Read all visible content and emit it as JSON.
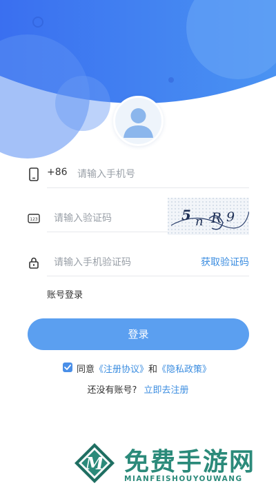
{
  "colors": {
    "header_blue": "#3d7af0",
    "accent_blue": "#3b8de0",
    "button_blue": "#5b9ff0",
    "watermark_green": "#2b8a7a"
  },
  "icons": {
    "phone": "phone-icon",
    "captcha": "captcha-123-icon",
    "lock": "lock-icon",
    "avatar": "user-avatar-icon",
    "checkbox": "check-icon"
  },
  "form": {
    "country_code": "+86",
    "phone_placeholder": "请输入手机号",
    "captcha_placeholder": "请输入验证码",
    "captcha_text": "5 n R 9",
    "sms_placeholder": "请输入手机验证码",
    "get_code_label": "获取验证码"
  },
  "account_login_label": "账号登录",
  "login_button_label": "登录",
  "agreement": {
    "checked": true,
    "prefix": "同意",
    "register_agreement": "《注册协议》",
    "and": "和",
    "privacy_policy": "《隐私政策》"
  },
  "signup": {
    "prompt": "还没有账号?",
    "link": "立即去注册"
  },
  "watermark": {
    "title": "免费手游网",
    "subtitle": "MIANFEISHOUYOUWANG"
  }
}
